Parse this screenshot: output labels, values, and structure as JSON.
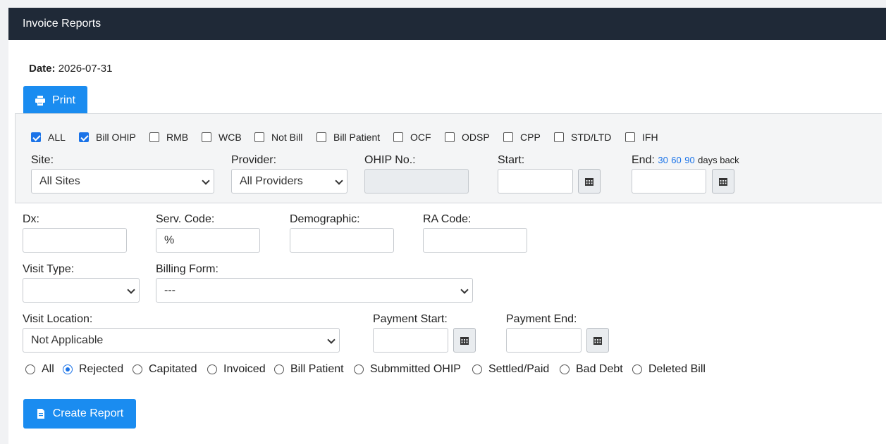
{
  "header": {
    "title": "Invoice Reports"
  },
  "date": {
    "label": "Date:",
    "value": "2026-07-31"
  },
  "print_button": {
    "label": "Print",
    "icon": "printer-icon"
  },
  "billing_types": [
    {
      "label": "ALL",
      "checked": true
    },
    {
      "label": "Bill OHIP",
      "checked": true
    },
    {
      "label": "RMB",
      "checked": false
    },
    {
      "label": "WCB",
      "checked": false
    },
    {
      "label": "Not Bill",
      "checked": false
    },
    {
      "label": "Bill Patient",
      "checked": false
    },
    {
      "label": "OCF",
      "checked": false
    },
    {
      "label": "ODSP",
      "checked": false
    },
    {
      "label": "CPP",
      "checked": false
    },
    {
      "label": "STD/LTD",
      "checked": false
    },
    {
      "label": "IFH",
      "checked": false
    }
  ],
  "site": {
    "label": "Site:",
    "value": "All Sites"
  },
  "provider": {
    "label": "Provider:",
    "value": "All Providers"
  },
  "ohip_no": {
    "label": "OHIP No.:",
    "value": ""
  },
  "start": {
    "label": "Start:",
    "value": ""
  },
  "end": {
    "label": "End:",
    "quick_links": [
      "30",
      "60",
      "90"
    ],
    "suffix": "days back",
    "value": ""
  },
  "dx": {
    "label": "Dx:",
    "value": ""
  },
  "serv_code": {
    "label": "Serv. Code:",
    "value": "%"
  },
  "demographic": {
    "label": "Demographic:",
    "value": ""
  },
  "ra_code": {
    "label": "RA Code:",
    "value": ""
  },
  "visit_type": {
    "label": "Visit Type:",
    "value": ""
  },
  "billing_form": {
    "label": "Billing Form:",
    "value": "---"
  },
  "visit_location": {
    "label": "Visit Location:",
    "value": "Not Applicable"
  },
  "payment_start": {
    "label": "Payment Start:",
    "value": ""
  },
  "payment_end": {
    "label": "Payment End:",
    "value": ""
  },
  "status_options": [
    {
      "label": "All",
      "selected": false
    },
    {
      "label": "Rejected",
      "selected": true
    },
    {
      "label": "Capitated",
      "selected": false
    },
    {
      "label": "Invoiced",
      "selected": false
    },
    {
      "label": "Bill Patient",
      "selected": false
    },
    {
      "label": "Submmitted OHIP",
      "selected": false
    },
    {
      "label": "Settled/Paid",
      "selected": false
    },
    {
      "label": "Bad Debt",
      "selected": false
    },
    {
      "label": "Deleted Bill",
      "selected": false
    }
  ],
  "create_button": {
    "label": "Create Report",
    "icon": "report-icon"
  },
  "colors": {
    "header_bg": "#1f2937",
    "primary": "#1a8cf0",
    "accent": "#1a73e8"
  }
}
